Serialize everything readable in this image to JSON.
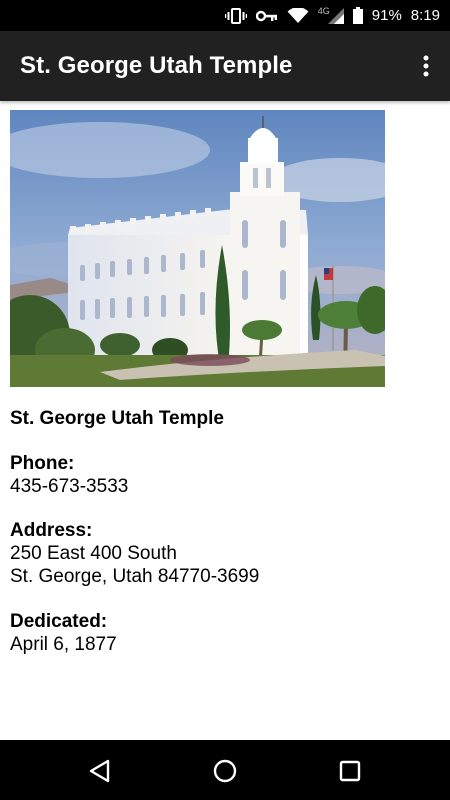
{
  "status_bar": {
    "network": "4G",
    "battery": "91%",
    "time": "8:19"
  },
  "app_bar": {
    "title": "St. George Utah Temple",
    "menu_icon": "more-vert-icon"
  },
  "temple": {
    "name": "St. George Utah Temple",
    "phone_label": "Phone:",
    "phone": "435-673-3533",
    "address_label": "Address:",
    "address_line1": "250 East 400 South",
    "address_line2": "St. George, Utah 84770-3699",
    "dedicated_label": "Dedicated:",
    "dedicated": "April 6, 1877"
  },
  "nav": {
    "back_icon": "back-triangle-icon",
    "home_icon": "home-circle-icon",
    "recent_icon": "recents-square-icon"
  }
}
